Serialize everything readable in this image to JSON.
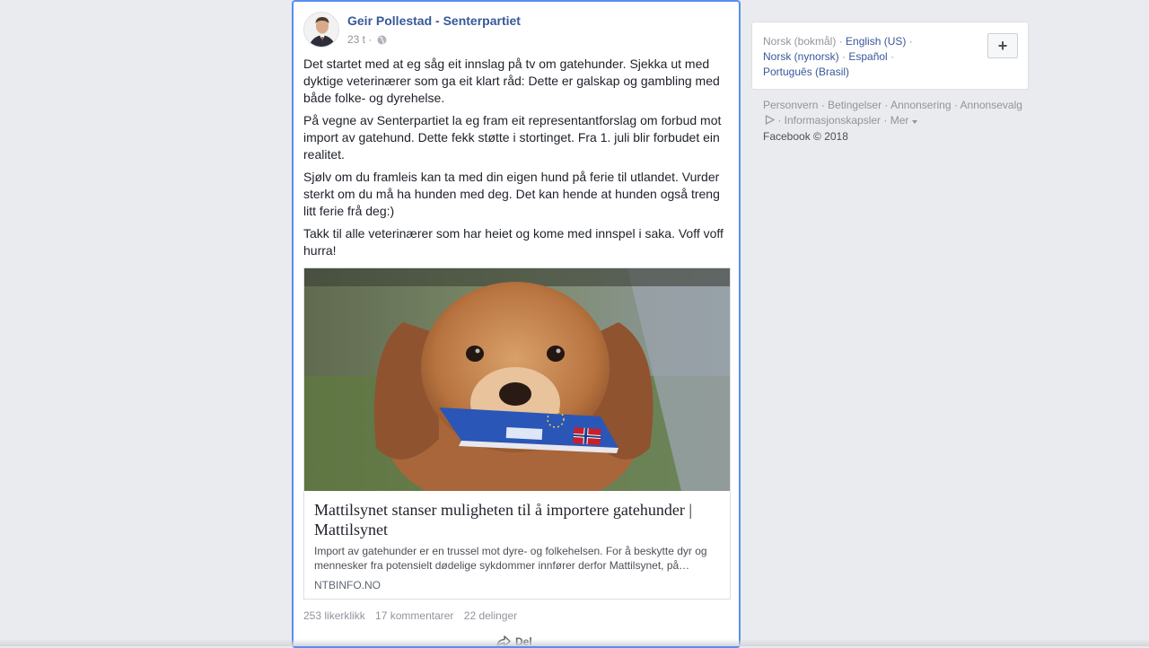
{
  "post": {
    "author": "Geir Pollestad - Senterpartiet",
    "time": "23 t",
    "separator": " · ",
    "paragraphs": [
      "Det startet med at eg såg eit innslag på tv om gatehunder. Sjekka ut med dyktige veterinærer som ga eit klart råd: Dette er galskap og gambling med både folke- og dyrehelse.",
      "På vegne av Senterpartiet la eg fram eit representantforslag om forbud mot import av gatehund. Dette fekk støtte i stortinget. Fra 1. juli blir forbudet ein realitet.",
      "Sjølv om du framleis kan ta med din eigen hund på ferie til utlandet. Vurder sterkt om du må ha hunden med deg. Det kan hende at hunden også treng litt ferie frå deg:)",
      "Takk til alle veterinærer som har heiet og kome med innspel i saka. Voff voff hurra!"
    ],
    "link": {
      "title": "Mattilsynet stanser muligheten til å importere gatehunder | Mattilsynet",
      "description": "Import av gatehunder er en trussel mot dyre- og folkehelsen. For å beskytte dyr og mennesker fra potensielt dødelige sykdommer innfører derfor Mattilsynet, på…",
      "domain": "NTBINFO.NO"
    },
    "stats": {
      "likes": "253 likerklikk",
      "comments": "17 kommentarer",
      "shares": "22 delinger"
    },
    "share_label": "Del"
  },
  "languages": {
    "current": "Norsk (bokmål)",
    "options": [
      "English (US)",
      "Norsk (nynorsk)",
      "Español",
      "Português (Brasil)"
    ],
    "add_label": "+"
  },
  "footer": {
    "links": [
      "Personvern",
      "Betingelser",
      "Annonsering",
      "Annonsevalg",
      "Informasjonskapsler",
      "Mer"
    ],
    "copyright": "Facebook © 2018"
  },
  "colors": {
    "link_blue": "#385898",
    "background": "#e9ebee",
    "focus_border": "#5b8def"
  }
}
